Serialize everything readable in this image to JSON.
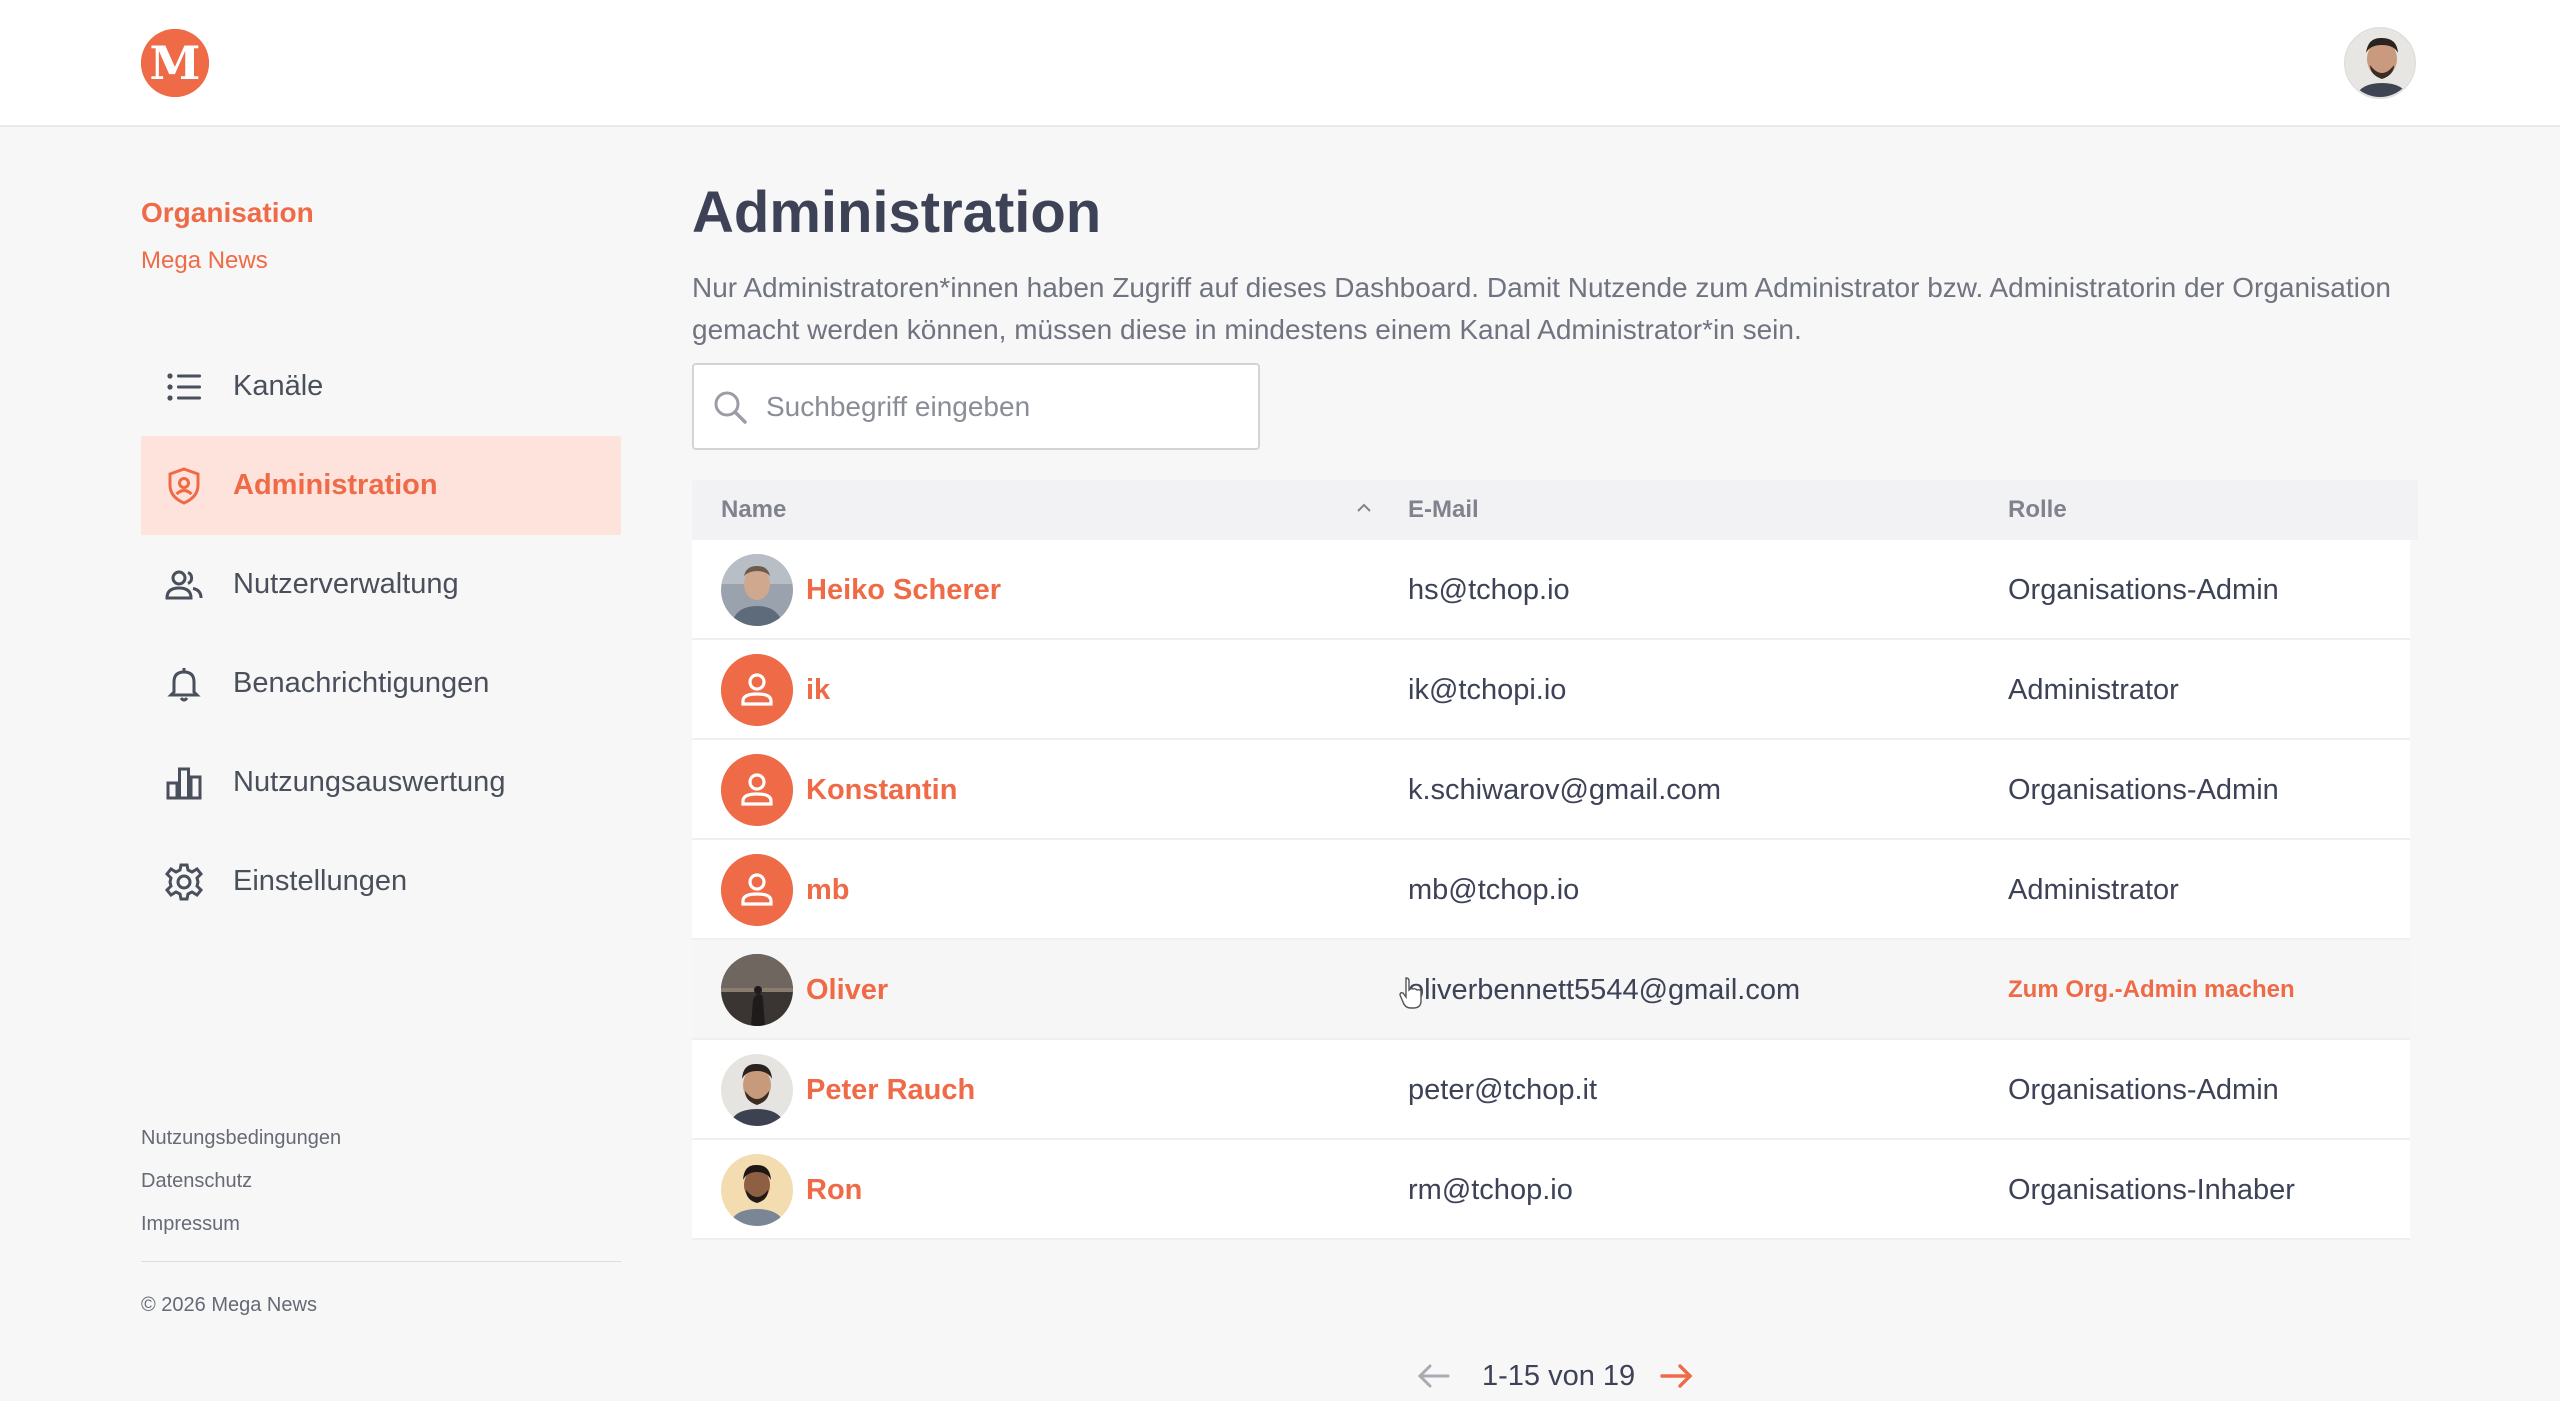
{
  "header": {
    "logo_letter": "M",
    "brand_color": "#ef6a47"
  },
  "sidebar": {
    "org_title": "Organisation",
    "org_name": "Mega News",
    "items": [
      {
        "label": "Kanäle",
        "icon": "list-icon",
        "active": false
      },
      {
        "label": "Administration",
        "icon": "shield-user-icon",
        "active": true
      },
      {
        "label": "Nutzerverwaltung",
        "icon": "users-icon",
        "active": false
      },
      {
        "label": "Benachrichtigungen",
        "icon": "bell-icon",
        "active": false
      },
      {
        "label": "Nutzungsauswertung",
        "icon": "bar-chart-icon",
        "active": false
      },
      {
        "label": "Einstellungen",
        "icon": "gear-icon",
        "active": false
      }
    ],
    "footer_links": [
      "Nutzungsbedingungen",
      "Datenschutz",
      "Impressum"
    ],
    "copyright": "© 2026 Mega News"
  },
  "main": {
    "title": "Administration",
    "description": "Nur Administratoren*innen haben Zugriff auf dieses Dashboard. Damit Nutzende zum Administrator bzw. Administratorin der Organisation gemacht werden können, müssen diese in mindestens einem Kanal Administrator*in sein.",
    "search": {
      "placeholder": "Suchbegriff eingeben",
      "value": ""
    },
    "table": {
      "columns": {
        "name": "Name",
        "email": "E-Mail",
        "role": "Rolle"
      },
      "rows": [
        {
          "name": "Heiko Scherer",
          "email": "hs@tchop.io",
          "role": "Organisations-Admin",
          "avatar": "photo"
        },
        {
          "name": "ik",
          "email": "ik@tchopi.io",
          "role": "Administrator",
          "avatar": "placeholder"
        },
        {
          "name": "Konstantin",
          "email": "k.schiwarov@gmail.com",
          "role": "Organisations-Admin",
          "avatar": "placeholder"
        },
        {
          "name": "mb",
          "email": "mb@tchop.io",
          "role": "Administrator",
          "avatar": "placeholder"
        },
        {
          "name": "Oliver",
          "email": "oliverbennett5544@gmail.com",
          "role": "Zum Org.-Admin machen",
          "avatar": "photo"
        },
        {
          "name": "Peter Rauch",
          "email": "peter@tchop.it",
          "role": "Organisations-Admin",
          "avatar": "photo"
        },
        {
          "name": "Ron",
          "email": "rm@tchop.io",
          "role": "Organisations-Inhaber",
          "avatar": "photo"
        }
      ]
    },
    "pagination": {
      "text": "1-15 von 19"
    }
  }
}
